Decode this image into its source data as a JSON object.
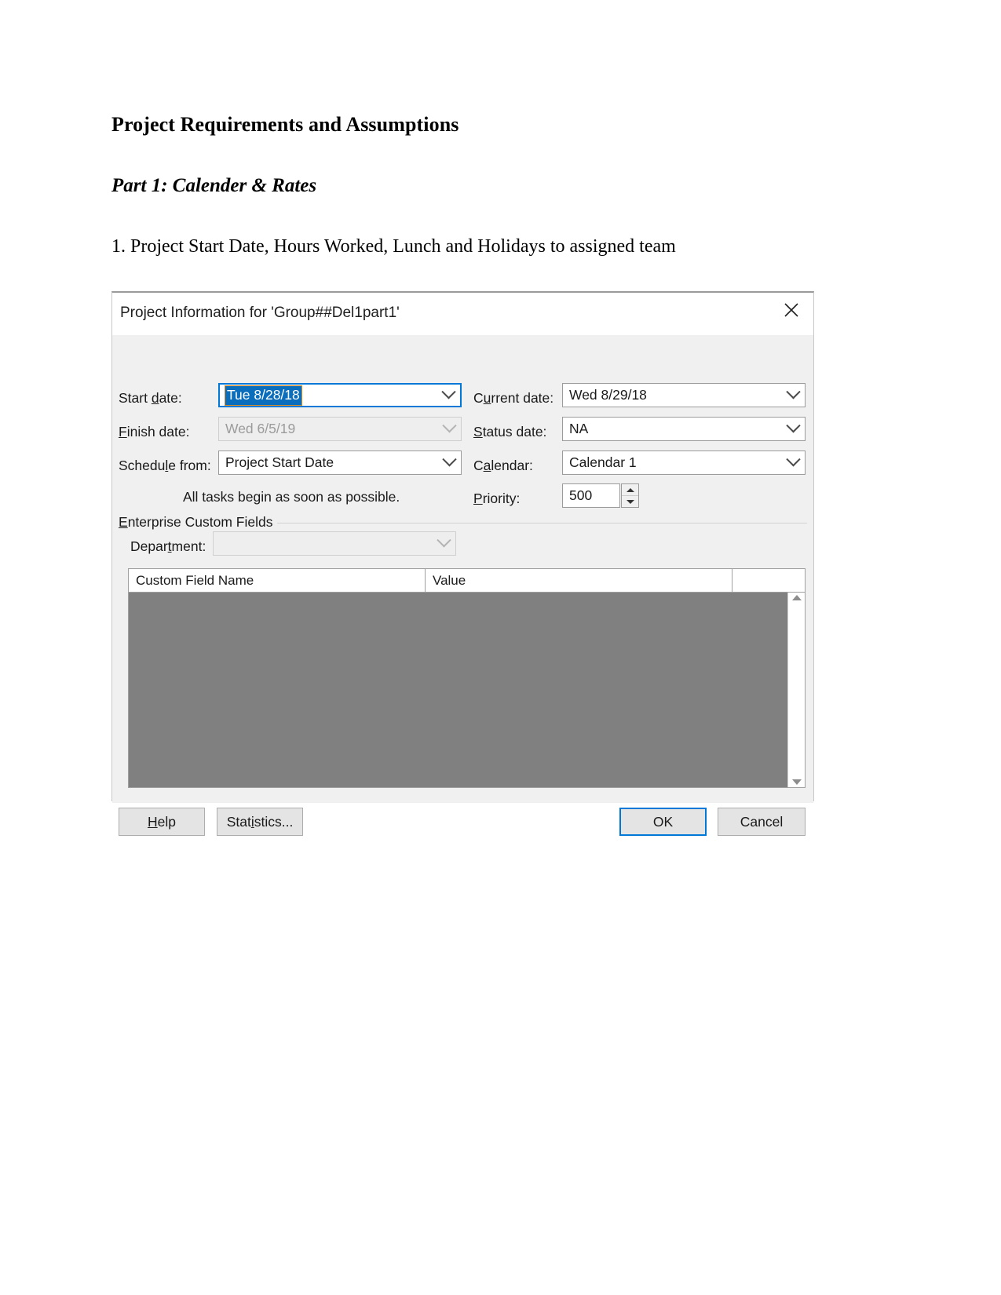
{
  "document": {
    "heading": "Project Requirements and Assumptions",
    "subheading": "Part 1: Calender & Rates",
    "paragraph": "1. Project Start Date, Hours Worked, Lunch and Holidays to assigned team"
  },
  "dialog": {
    "title": "Project Information for 'Group##Del1part1'",
    "close_icon": "close-icon",
    "fields": {
      "start_date": {
        "label_pre": "Start ",
        "label_accel": "d",
        "label_post": "ate:",
        "value": "Tue 8/28/18",
        "state": "focused-selected"
      },
      "finish_date": {
        "label_pre": "",
        "label_accel": "F",
        "label_post": "inish date:",
        "value": "Wed 6/5/19",
        "state": "disabled"
      },
      "schedule_from": {
        "label_pre": "Schedu",
        "label_accel": "l",
        "label_post": "e from:",
        "value": "Project Start Date",
        "state": "normal"
      },
      "current_date": {
        "label_pre": "C",
        "label_accel": "u",
        "label_post": "rrent date:",
        "value": "Wed 8/29/18",
        "state": "normal"
      },
      "status_date": {
        "label_pre": "",
        "label_accel": "S",
        "label_post": "tatus date:",
        "value": "NA",
        "state": "normal"
      },
      "calendar": {
        "label_pre": "C",
        "label_accel": "a",
        "label_post": "lendar:",
        "value": "Calendar 1",
        "state": "normal"
      },
      "priority": {
        "label_pre": "",
        "label_accel": "P",
        "label_post": "riority:",
        "value": "500"
      },
      "department": {
        "label_pre": "Depar",
        "label_accel": "t",
        "label_post": "ment:",
        "value": "",
        "state": "disabled"
      }
    },
    "scheduling_note": "All tasks begin as soon as possible.",
    "group": {
      "label_pre": "",
      "label_accel": "E",
      "label_post": "nterprise Custom Fields"
    },
    "grid": {
      "columns": [
        "Custom Field Name",
        "Value",
        ""
      ],
      "rows": []
    },
    "buttons": {
      "help": {
        "pre": "",
        "accel": "H",
        "post": "elp"
      },
      "statistics": {
        "pre": "Stat",
        "accel": "i",
        "post": "stics..."
      },
      "ok": "OK",
      "cancel": "Cancel"
    }
  },
  "colors": {
    "accent": "#0078d7",
    "selection": "#0a6ebd",
    "grid_body": "#808080",
    "dialog_bg": "#f0f0f0"
  }
}
